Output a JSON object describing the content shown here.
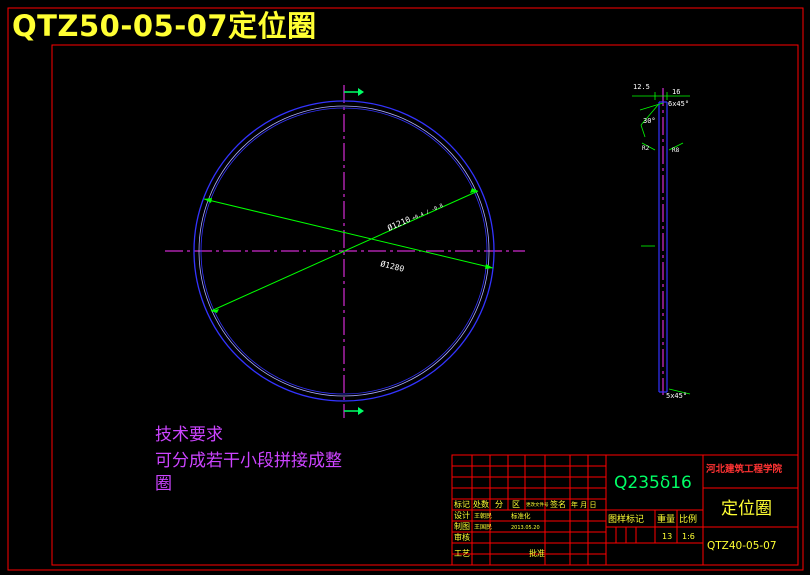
{
  "title": "QTZ50-05-07定位圈",
  "colors": {
    "background": "#000000",
    "frame": "#ff0000",
    "title": "#ffff33",
    "ring": "#3333ff",
    "ring_inner": "#aaaaff",
    "centerline": "#ff33ff",
    "dimension": "#00ff00",
    "dim_text": "#ffffff",
    "requirements": "#cc44ff",
    "title_block_text": "#ffff33",
    "title_block_green": "#00ff66"
  },
  "plan_view": {
    "dim_outer": "Ø1210",
    "dim_outer_tol": "+0.4 / -0.8",
    "dim_inner": "Ø1280"
  },
  "side_view": {
    "dim_top_left": "12.5",
    "dim_top_right": "16",
    "chamfer_top": "6x45°",
    "angle": "30°",
    "side_mark_left": "R2",
    "side_mark_right": "R8",
    "chamfer_bottom": "5x45°"
  },
  "requirements": {
    "heading": "技术要求",
    "line1": "可分成若干小段拼接成整",
    "line2": "圈"
  },
  "title_block": {
    "material": "Q235δ16",
    "school": "河北建筑工程学院",
    "part_name": "定位圈",
    "drawing_no": "QTZ40-05-07",
    "hdr_mark": "标记",
    "hdr_count": "处数",
    "hdr_zone": "分",
    "hdr_region": "区",
    "hdr_change_no": "更改文件号",
    "hdr_signature": "签名",
    "hdr_date": "年 月 日",
    "role_design": "设计",
    "designer": "王朝民",
    "role_standard": "标准化",
    "role_drawing": "制图",
    "drafter": "王国民",
    "draw_date": "2013.05.20",
    "role_review": "审核",
    "role_process": "工艺",
    "role_approve": "批准",
    "stage_label": "图样标记",
    "weight_label": "重量",
    "scale_label": "比例",
    "weight_value": "13",
    "scale_value": "1:6"
  }
}
